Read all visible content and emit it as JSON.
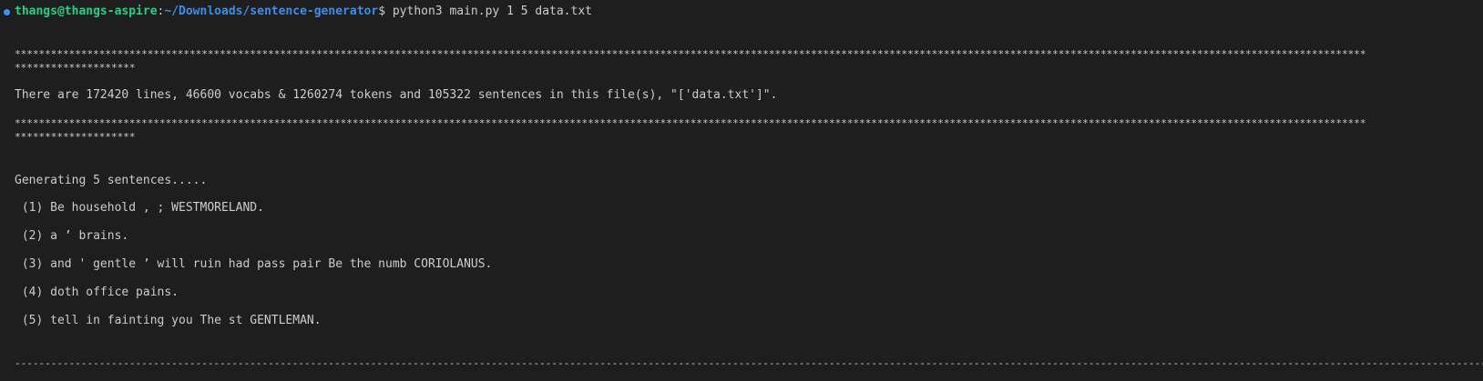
{
  "prompt": {
    "user_host": "thangs@thangs-aspire",
    "separator": ":",
    "path": "~/Downloads/sentence-generator",
    "symbol": "$ ",
    "command": "python3 main.py 1 5 data.txt"
  },
  "output": {
    "stars_row_1a": "********************************************************************************************************************************************************************************************************************************",
    "stars_row_1b": "********************",
    "stats_line": "There are 172420 lines, 46600 vocabs & 1260274 tokens and 105322 sentences in this file(s), \"['data.txt']\".",
    "stars_row_2a": "********************************************************************************************************************************************************************************************************************************",
    "stars_row_2b": "********************",
    "generating_line": "Generating 5 sentences.....",
    "sentences": [
      " (1) Be household , ; WESTMORELAND.",
      " (2) a ’ brains.",
      " (3) and ' gentle ’ will ruin had pass pair Be the numb CORIOLANUS.",
      " (4) doth office pains.",
      " (5) tell in fainting you The st GENTLEMAN."
    ],
    "dash_row": "--------------------------------------------------------------------------------------------------------------------------------------------------------------------------------------------------------------------------------------------------------------"
  },
  "colors": {
    "background": "#1e1e1e",
    "foreground": "#cccccc",
    "user_host": "#23d18b",
    "path": "#3b8eea",
    "status_dot": "#3794ff"
  }
}
